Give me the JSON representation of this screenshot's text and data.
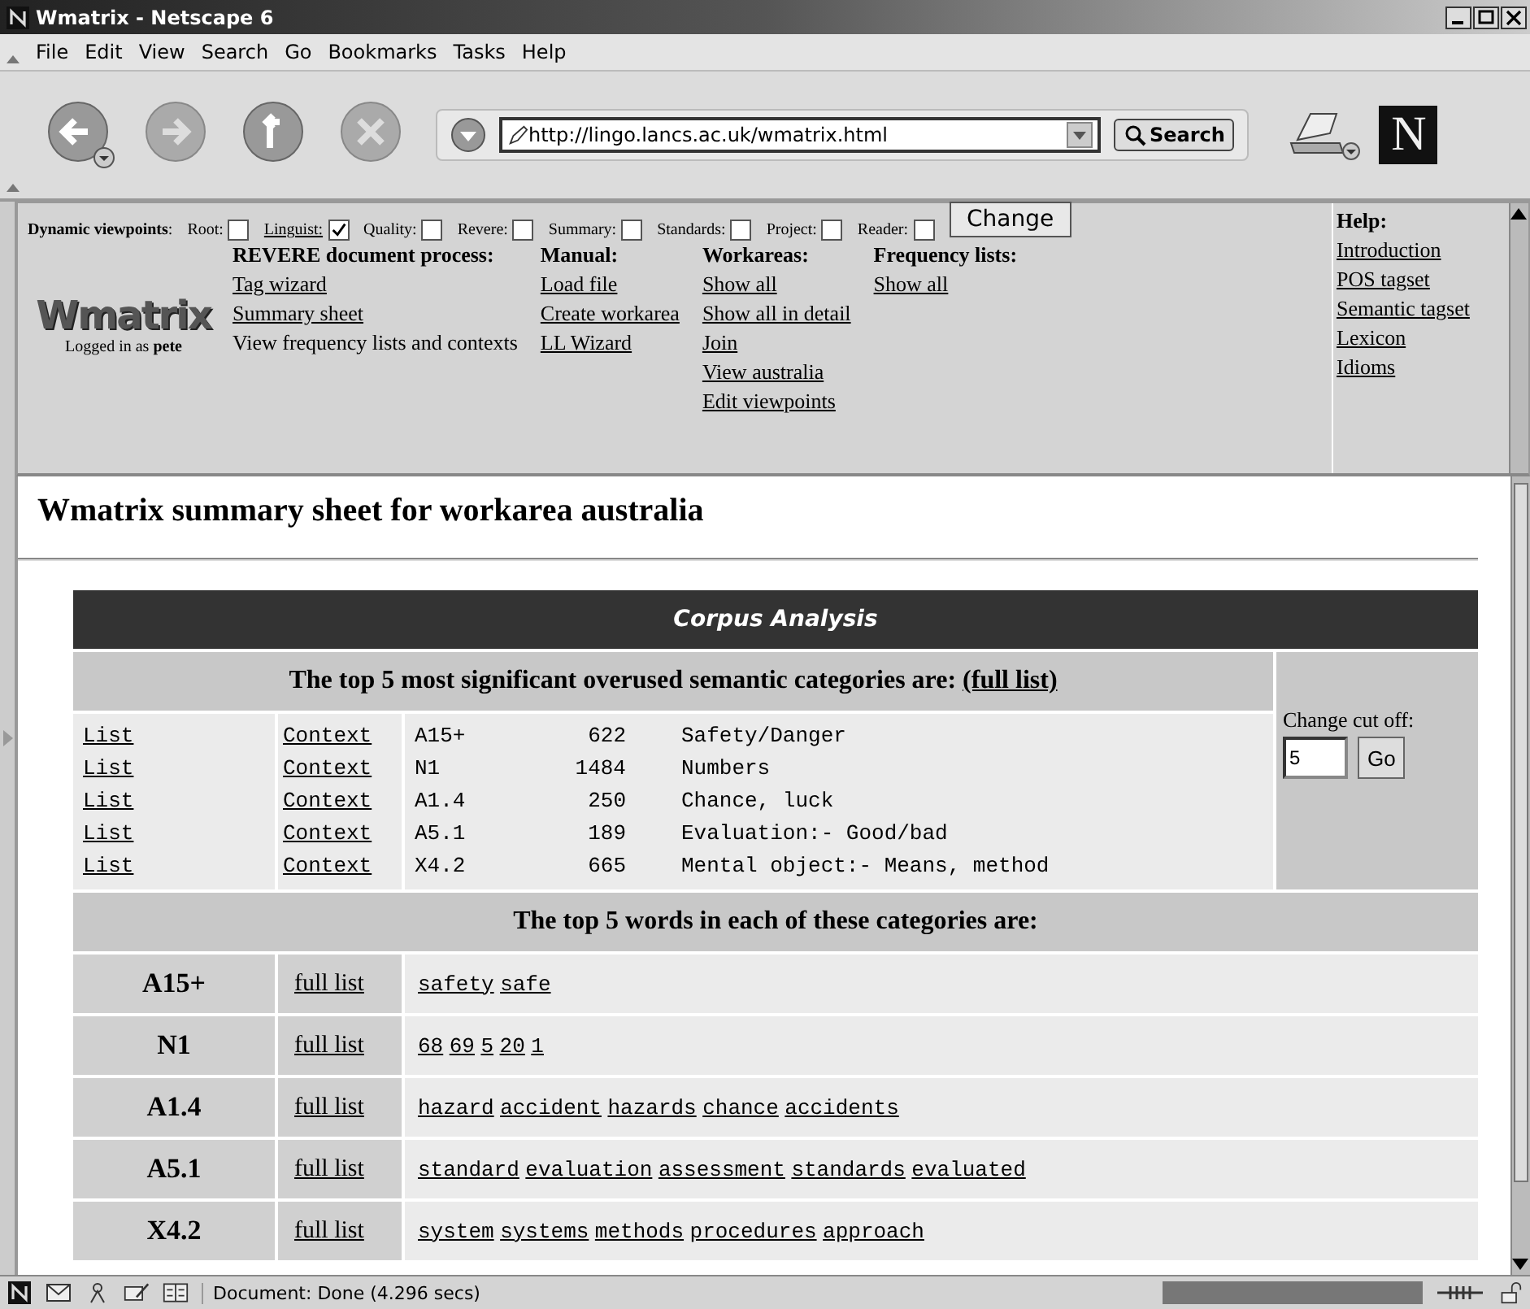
{
  "window": {
    "title": "Wmatrix - Netscape 6"
  },
  "menu": [
    "File",
    "Edit",
    "View",
    "Search",
    "Go",
    "Bookmarks",
    "Tasks",
    "Help"
  ],
  "toolbar": {
    "url": "http://lingo.lancs.ac.uk/wmatrix.html",
    "search": "Search",
    "brand": "N"
  },
  "nav": {
    "viewpoints_label": "**Dynamic viewpoints**:",
    "viewpoints": [
      {
        "label": "Root:",
        "checked": false,
        "link": false
      },
      {
        "label": "Linguist:",
        "checked": true,
        "link": true
      },
      {
        "label": "Quality:",
        "checked": false,
        "link": false
      },
      {
        "label": "Revere:",
        "checked": false,
        "link": false
      },
      {
        "label": "Summary:",
        "checked": false,
        "link": false
      },
      {
        "label": "Standards:",
        "checked": false,
        "link": false
      },
      {
        "label": "Project:",
        "checked": false,
        "link": false
      },
      {
        "label": "Reader:",
        "checked": false,
        "link": false
      }
    ],
    "change": "Change",
    "logo": "Wmatrix",
    "logged_in": "Logged in as **pete**",
    "columns": [
      {
        "heading": "REVERE document process:",
        "items": [
          {
            "text": "Tag wizard",
            "link": true
          },
          {
            "text": "Summary sheet",
            "link": true
          },
          {
            "text": "View frequency lists and contexts",
            "link": false
          }
        ]
      },
      {
        "heading": "Manual:",
        "items": [
          {
            "text": "Load file",
            "link": true
          },
          {
            "text": "Create workarea",
            "link": true
          },
          {
            "text": "LL Wizard",
            "link": true
          }
        ]
      },
      {
        "heading": "Workareas:",
        "items": [
          {
            "text": "Show all",
            "link": true
          },
          {
            "text": "Show all in detail",
            "link": true
          },
          {
            "text": "Join",
            "link": true
          },
          {
            "text": "View australia",
            "link": true
          },
          {
            "text": "Edit viewpoints",
            "link": true
          }
        ]
      },
      {
        "heading": "Frequency lists:",
        "items": [
          {
            "text": "Show all",
            "link": true
          }
        ]
      }
    ],
    "help": {
      "heading": "Help:",
      "items": [
        "Introduction",
        "POS tagset",
        "Semantic tagset",
        "Lexicon",
        "Idioms"
      ]
    }
  },
  "page_title": "Wmatrix summary sheet for workarea australia",
  "analysis": {
    "title": "Corpus Analysis",
    "overused_heading": "The top 5 most significant overused semantic categories are:",
    "full_list": "(full list)",
    "categories": [
      {
        "list": "List",
        "context": "Context",
        "tag": "A15+",
        "count": "622",
        "name": "Safety/Danger"
      },
      {
        "list": "List",
        "context": "Context",
        "tag": "N1",
        "count": "1484",
        "name": "Numbers"
      },
      {
        "list": "List",
        "context": "Context",
        "tag": "A1.4",
        "count": "250",
        "name": "Chance, luck"
      },
      {
        "list": "List",
        "context": "Context",
        "tag": "A5.1",
        "count": "189",
        "name": "Evaluation:- Good/bad"
      },
      {
        "list": "List",
        "context": "Context",
        "tag": "X4.2",
        "count": "665",
        "name": "Mental object:- Means, method"
      }
    ],
    "cutoff_label": "Change cut off:",
    "cutoff_value": "5",
    "go": "Go",
    "words_heading": "The top 5 words in each of these categories are:",
    "word_rows": [
      {
        "tag": "A15+",
        "full_list": "full list",
        "words": [
          "safety",
          "safe"
        ]
      },
      {
        "tag": "N1",
        "full_list": "full list",
        "words": [
          "68",
          "69",
          "5",
          "20",
          "1"
        ]
      },
      {
        "tag": "A1.4",
        "full_list": "full list",
        "words": [
          "hazard",
          "accident",
          "hazards",
          "chance",
          "accidents"
        ]
      },
      {
        "tag": "A5.1",
        "full_list": "full list",
        "words": [
          "standard",
          "evaluation",
          "assessment",
          "standards",
          "evaluated"
        ]
      },
      {
        "tag": "X4.2",
        "full_list": "full list",
        "words": [
          "system",
          "systems",
          "methods",
          "procedures",
          "approach"
        ]
      }
    ]
  },
  "status": "Document: Done (4.296 secs)"
}
